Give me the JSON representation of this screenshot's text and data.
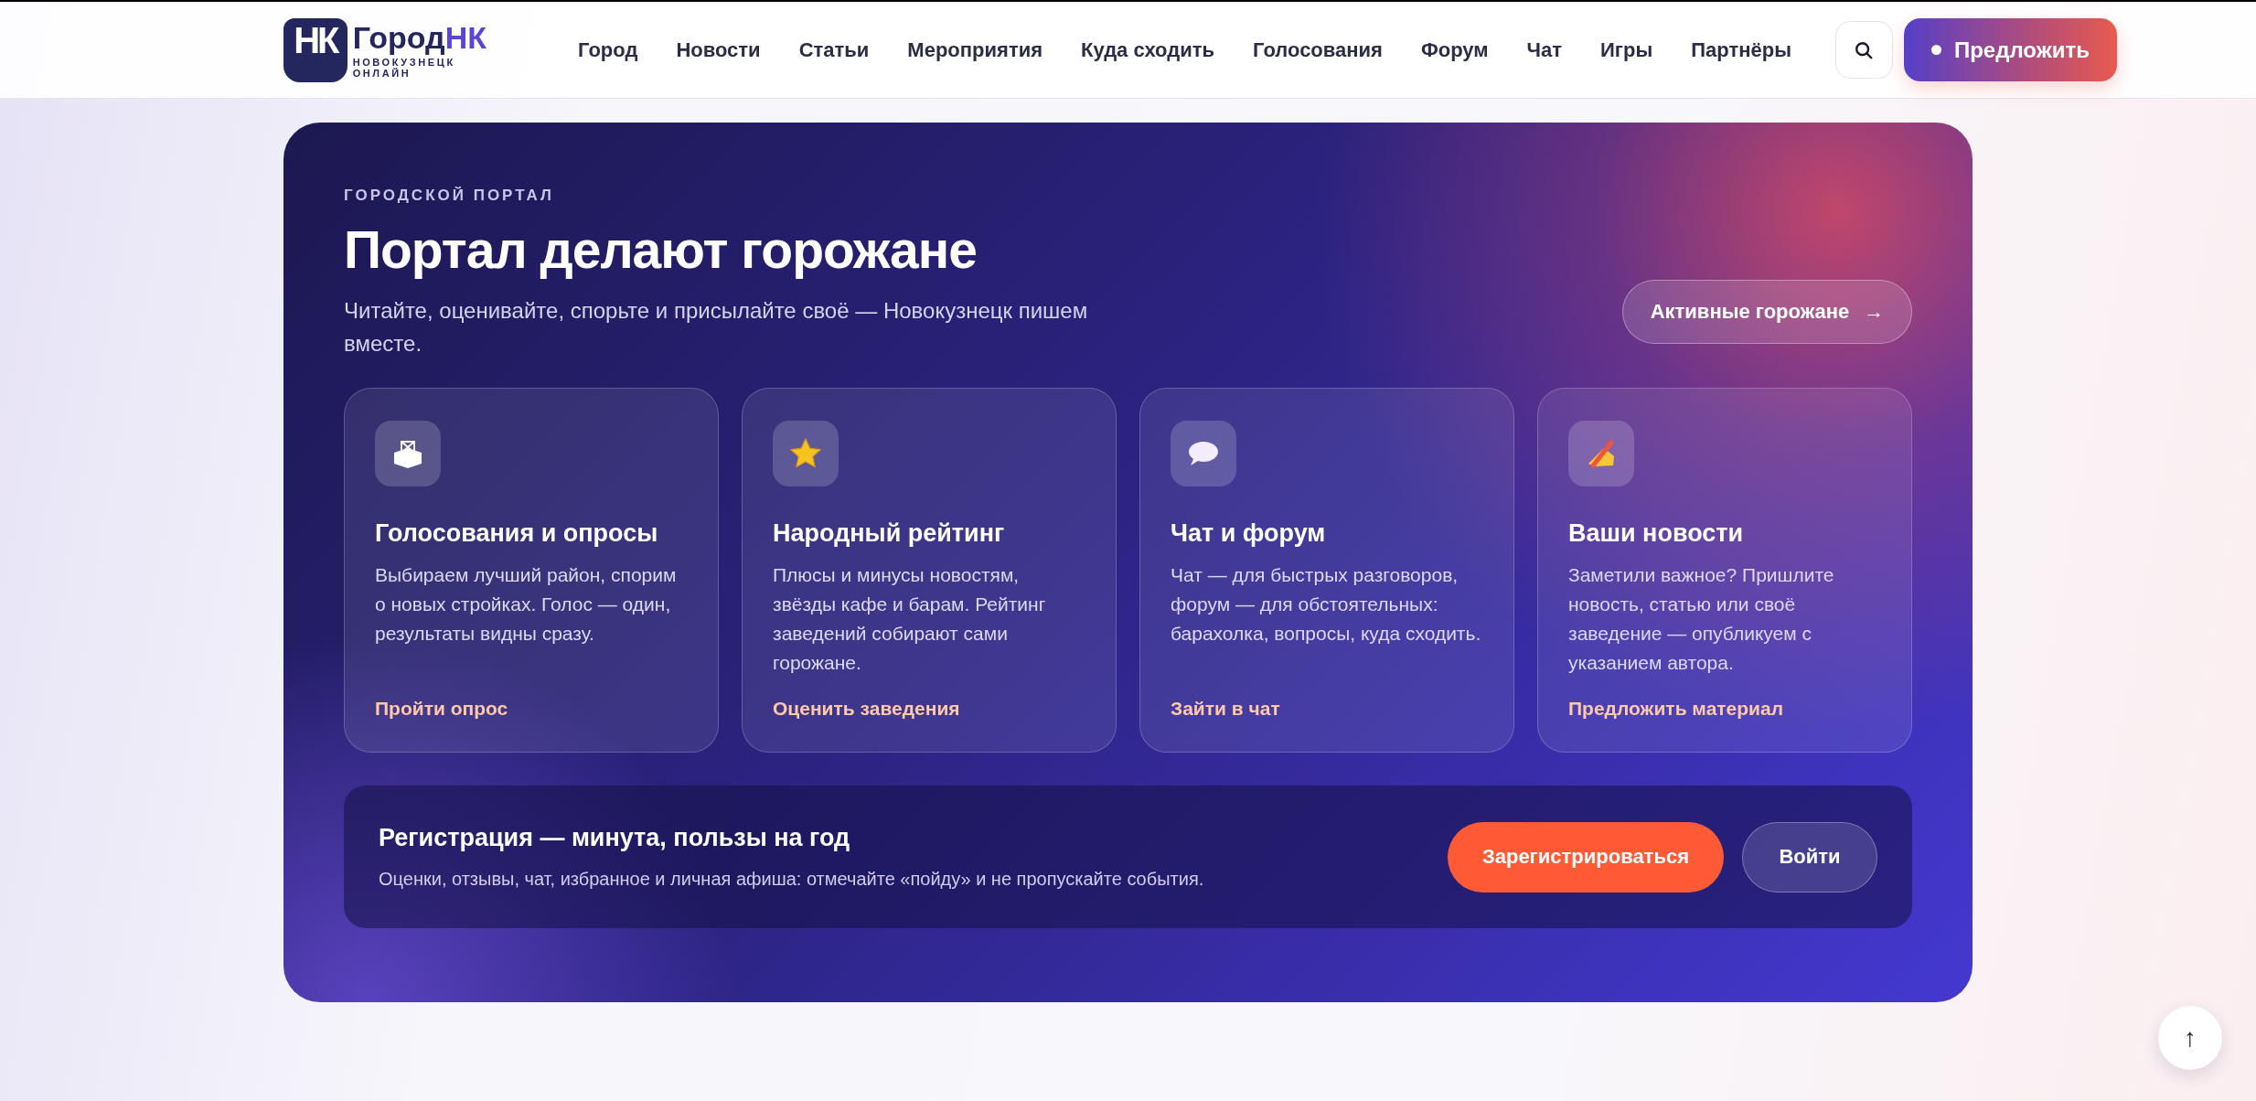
{
  "header": {
    "logo": {
      "mark": "НК",
      "name_main": "Город",
      "name_accent": "НК",
      "tagline": "НОВОКУЗНЕЦК ОНЛАЙН"
    },
    "nav": [
      {
        "label": "Город"
      },
      {
        "label": "Новости"
      },
      {
        "label": "Статьи"
      },
      {
        "label": "Мероприятия"
      },
      {
        "label": "Куда сходить"
      },
      {
        "label": "Голосования"
      },
      {
        "label": "Форум"
      },
      {
        "label": "Чат"
      },
      {
        "label": "Игры"
      },
      {
        "label": "Партнёры"
      }
    ],
    "suggest_button": "Предложить"
  },
  "hero": {
    "kicker": "ГОРОДСКОЙ ПОРТАЛ",
    "title": "Портал делают горожане",
    "subtitle": "Читайте, оценивайте, спорьте и присылайте своё — Новокузнецк пишем вместе.",
    "active_button": "Активные горожане",
    "active_arrow": "→",
    "cards": [
      {
        "kind": "ballot",
        "title": "Голосования и опросы",
        "text": "Выбираем лучший район, спорим о новых стройках. Голос — один, результаты видны сразу.",
        "link": "Пройти опрос"
      },
      {
        "kind": "star",
        "title": "Народный рейтинг",
        "text": "Плюсы и минусы новостям, звёзды кафе и барам. Рейтинг заведений собирают сами горожане.",
        "link": "Оценить заведения"
      },
      {
        "kind": "chat",
        "title": "Чат и форум",
        "text": "Чат — для быстрых разговоров, форум — для обстоятельных: барахолка, вопросы, куда сходить.",
        "link": "Зайти в чат"
      },
      {
        "kind": "writing",
        "title": "Ваши новости",
        "text": "Заметили важное? Пришлите новость, статью или своё заведение — опубликуем с указанием автора.",
        "link": "Предложить материал"
      }
    ],
    "register": {
      "title": "Регистрация — минута, пользы на год",
      "text": "Оценки, отзывы, чат, избранное и личная афиша: отмечайте «пойду» и не пропускайте события.",
      "register_button": "Зарегистрироваться",
      "login_button": "Войти"
    }
  },
  "scroll_top": "↑"
}
